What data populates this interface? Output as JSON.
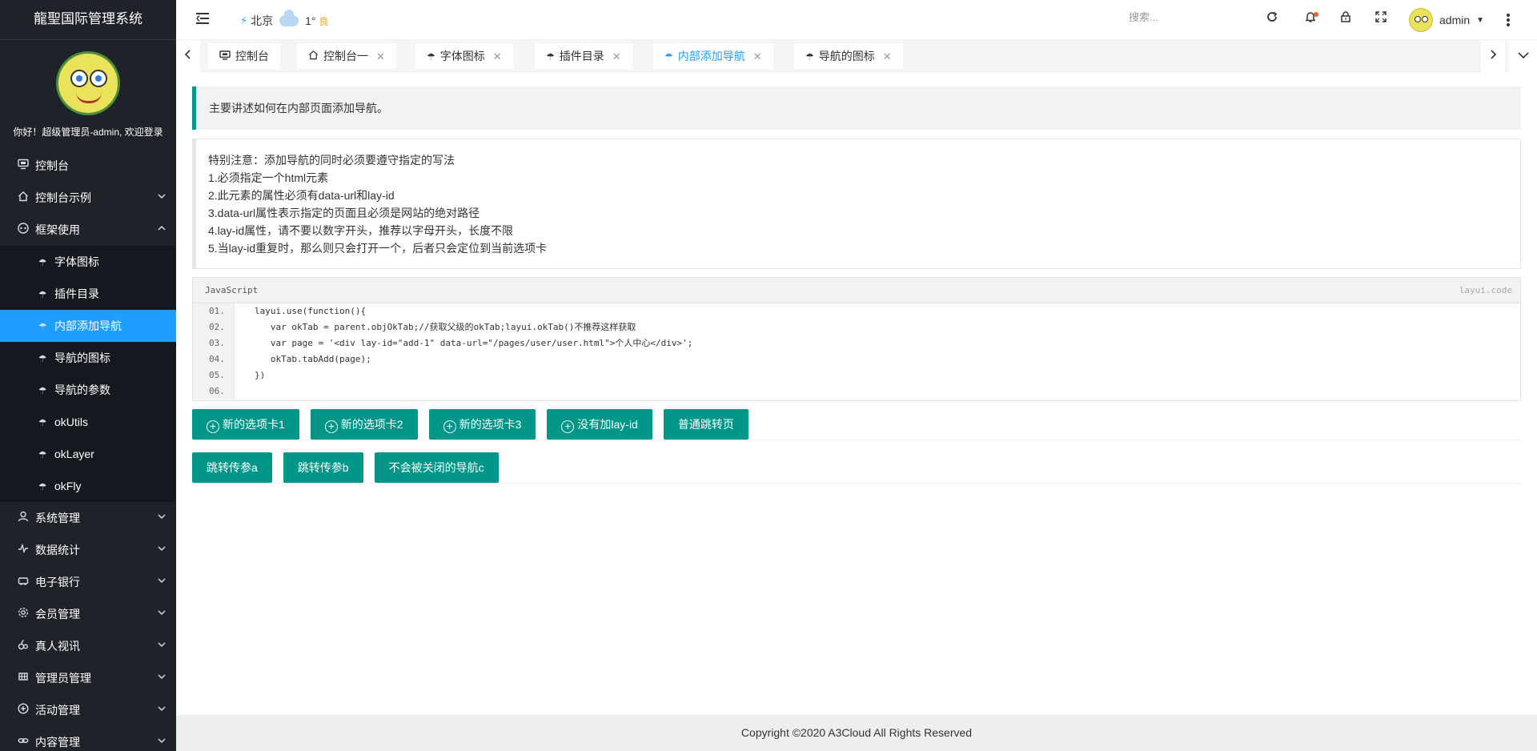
{
  "app": {
    "title": "龍聖国际管理系统"
  },
  "sidebar": {
    "greeting": "你好！超级管理员-admin, 欢迎登录",
    "items": [
      {
        "label": "控制台",
        "icon": "monitor-icon",
        "has_arrow": false
      },
      {
        "label": "控制台示例",
        "icon": "home-icon",
        "has_arrow": true
      },
      {
        "label": "框架使用",
        "icon": "framework-icon",
        "has_arrow": true,
        "expanded": true
      }
    ],
    "sub_items": [
      {
        "label": "字体图标"
      },
      {
        "label": "插件目录"
      },
      {
        "label": "内部添加导航",
        "active": true
      },
      {
        "label": "导航的图标"
      },
      {
        "label": "导航的参数"
      },
      {
        "label": "okUtils"
      },
      {
        "label": "okLayer"
      },
      {
        "label": "okFly"
      }
    ],
    "items_after": [
      {
        "label": "系统管理",
        "icon": "user-icon"
      },
      {
        "label": "数据统计",
        "icon": "pulse-icon"
      },
      {
        "label": "电子银行",
        "icon": "bank-icon"
      },
      {
        "label": "会员管理",
        "icon": "gear-icon"
      },
      {
        "label": "真人视讯",
        "icon": "video-icon"
      },
      {
        "label": "管理员管理",
        "icon": "grid-icon"
      },
      {
        "label": "活动管理",
        "icon": "plus-circle-icon"
      },
      {
        "label": "内容管理",
        "icon": "link-icon"
      }
    ]
  },
  "header": {
    "weather": {
      "city": "北京",
      "temp": "1°",
      "aqi": "良"
    },
    "search_placeholder": "搜索...",
    "user_name": "admin"
  },
  "tabs": [
    {
      "label": "控制台",
      "icon": "monitor-icon",
      "closable": false
    },
    {
      "label": "控制台一",
      "icon": "home-icon",
      "closable": true
    },
    {
      "label": "字体图标",
      "icon": "umbrella-icon",
      "closable": true
    },
    {
      "label": "插件目录",
      "icon": "umbrella-icon",
      "closable": true
    },
    {
      "label": "内部添加导航",
      "icon": "umbrella-icon",
      "closable": true,
      "active": true
    },
    {
      "label": "导航的图标",
      "icon": "umbrella-icon",
      "closable": true
    }
  ],
  "content": {
    "intro": "主要讲述如何在内部页面添加导航。",
    "notes": [
      "特别注意：添加导航的同时必须要遵守指定的写法",
      "1.必须指定一个html元素",
      "2.此元素的属性必须有data-url和lay-id",
      "3.data-url属性表示指定的页面且必须是网站的绝对路径",
      "4.lay-id属性，请不要以数字开头，推荐以字母开头，长度不限",
      "5.当lay-id重复时，那么则只会打开一个，后者只会定位到当前选项卡"
    ],
    "code": {
      "lang": "JavaScript",
      "brand": "layui.code",
      "lines": [
        {
          "n": "01.",
          "text": "layui.use(function(){"
        },
        {
          "n": "02.",
          "text": "   var okTab = parent.objOkTab;//获取父级的okTab;layui.okTab()不推荐这样获取"
        },
        {
          "n": "03.",
          "text": "   var page = '<div lay-id=\"add-1\" data-url=\"/pages/user/user.html\">个人中心</div>';"
        },
        {
          "n": "04.",
          "text": "   okTab.tabAdd(page);"
        },
        {
          "n": "05.",
          "text": "})"
        },
        {
          "n": "06.",
          "text": ""
        }
      ]
    },
    "buttons_row1": [
      {
        "label": "新的选项卡1",
        "plus": true
      },
      {
        "label": "新的选项卡2",
        "plus": true
      },
      {
        "label": "新的选项卡3",
        "plus": true
      },
      {
        "label": "没有加lay-id",
        "plus": true
      },
      {
        "label": "普通跳转页",
        "plus": false
      }
    ],
    "buttons_row2": [
      {
        "label": "跳转传参a"
      },
      {
        "label": "跳转传参b"
      },
      {
        "label": "不会被关闭的导航c"
      }
    ]
  },
  "footer": {
    "copyright": "Copyright ©2020 A3Cloud All Rights Reserved"
  },
  "colors": {
    "sidebar_bg": "#20222a",
    "active": "#1e9fff",
    "primary": "#009688"
  }
}
